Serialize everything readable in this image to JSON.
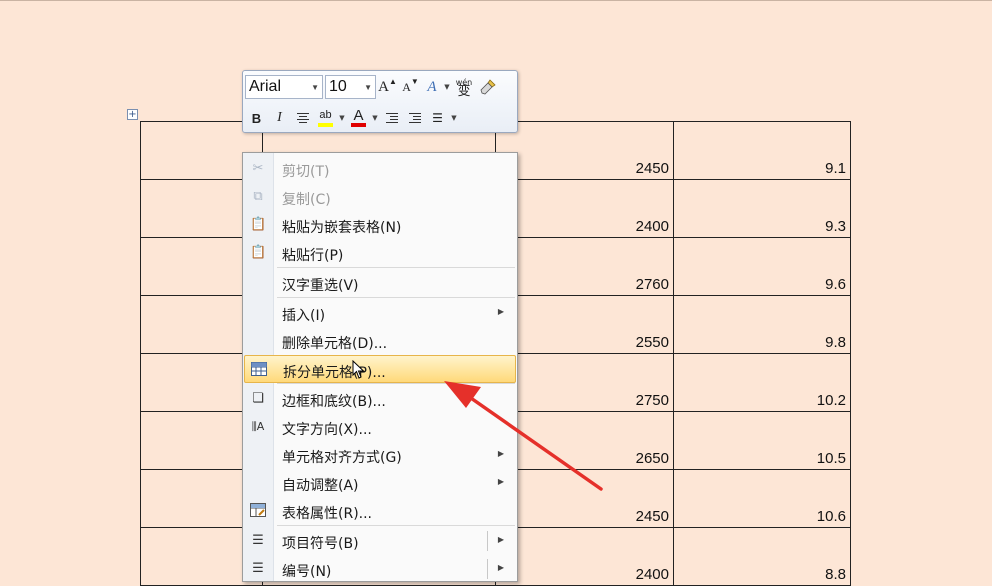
{
  "mini_toolbar": {
    "font_name": "Arial",
    "font_size": "10",
    "grow_font": "A",
    "shrink_font": "A",
    "styles": "A",
    "phonetic_top": "wén",
    "phonetic_char": "变",
    "bold": "B",
    "italic": "I",
    "highlight": "ab",
    "font_color": "A",
    "highlight_color": "#ffff00",
    "font_color_value": "#e00000"
  },
  "table": {
    "rows": [
      {
        "c3": "2450",
        "c4": "9.1"
      },
      {
        "c3": "2400",
        "c4": "9.3"
      },
      {
        "c3": "2760",
        "c4": "9.6"
      },
      {
        "c3": "2550",
        "c4": "9.8"
      },
      {
        "c3": "2750",
        "c4": "10.2"
      },
      {
        "c3": "2650",
        "c4": "10.5"
      },
      {
        "c3": "2450",
        "c4": "10.6"
      },
      {
        "c3": "2400",
        "c4": "8.8"
      }
    ]
  },
  "context_menu": {
    "items": [
      {
        "label": "剪切(T)",
        "icon": "scissors-icon"
      },
      {
        "label": "复制(C)",
        "icon": "copy-icon"
      },
      {
        "label": "粘贴为嵌套表格(N)",
        "icon": "paste-icon"
      },
      {
        "label": "粘贴行(P)",
        "icon": "paste-icon"
      },
      {
        "label": "汉字重选(V)"
      },
      {
        "label": "插入(I)"
      },
      {
        "label": "删除单元格(D)..."
      },
      {
        "label": "拆分单元格(P)...",
        "icon": "split-cells-icon"
      },
      {
        "label": "边框和底纹(B)...",
        "icon": "borders-icon"
      },
      {
        "label": "文字方向(X)...",
        "icon": "text-direction-icon"
      },
      {
        "label": "单元格对齐方式(G)"
      },
      {
        "label": "自动调整(A)"
      },
      {
        "label": "表格属性(R)...",
        "icon": "table-properties-icon"
      },
      {
        "label": "项目符号(B)",
        "icon": "bullets-icon"
      },
      {
        "label": "编号(N)",
        "icon": "numbering-icon"
      }
    ]
  },
  "colors": {
    "page_bg": "#fde6d6",
    "highlight_row": "#ffd97a",
    "annotation_arrow": "#e5302a"
  }
}
